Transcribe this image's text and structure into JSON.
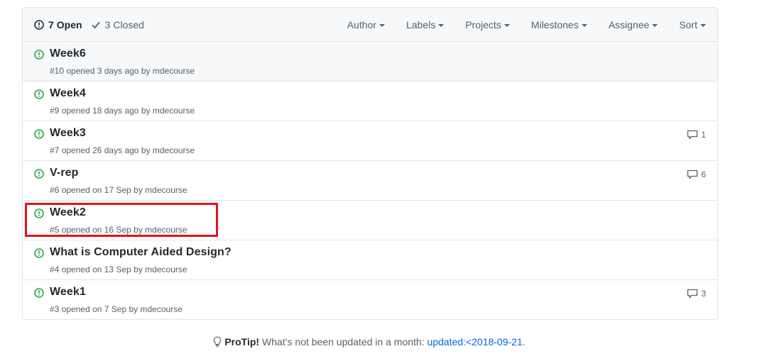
{
  "states": {
    "open_count": "7",
    "open_label": "Open",
    "closed_count": "3",
    "closed_label": "Closed"
  },
  "filters": [
    {
      "label": "Author"
    },
    {
      "label": "Labels"
    },
    {
      "label": "Projects"
    },
    {
      "label": "Milestones"
    },
    {
      "label": "Assignee"
    },
    {
      "label": "Sort"
    }
  ],
  "issues": [
    {
      "title": "Week6",
      "number": "#10",
      "opened": "opened 3 days ago",
      "by": "by",
      "author": "mdecourse",
      "comments": ""
    },
    {
      "title": "Week4",
      "number": "#9",
      "opened": "opened 18 days ago",
      "by": "by",
      "author": "mdecourse",
      "comments": ""
    },
    {
      "title": "Week3",
      "number": "#7",
      "opened": "opened 26 days ago",
      "by": "by",
      "author": "mdecourse",
      "comments": "1"
    },
    {
      "title": "V-rep",
      "number": "#6",
      "opened": "opened on 17 Sep",
      "by": "by",
      "author": "mdecourse",
      "comments": "6"
    },
    {
      "title": "Week2",
      "number": "#5",
      "opened": "opened on 16 Sep",
      "by": "by",
      "author": "mdecourse",
      "comments": ""
    },
    {
      "title": "What is Computer Aided Design?",
      "number": "#4",
      "opened": "opened on 13 Sep",
      "by": "by",
      "author": "mdecourse",
      "comments": ""
    },
    {
      "title": "Week1",
      "number": "#3",
      "opened": "opened on 7 Sep",
      "by": "by",
      "author": "mdecourse",
      "comments": "3"
    }
  ],
  "protip": {
    "label": "ProTip!",
    "text": " What’s not been updated in a month: ",
    "link": "updated:<2018-09-21",
    "suffix": "."
  },
  "colors": {
    "open_icon": "#28a745",
    "highlight": "#e0141e",
    "link": "#0366d6"
  }
}
